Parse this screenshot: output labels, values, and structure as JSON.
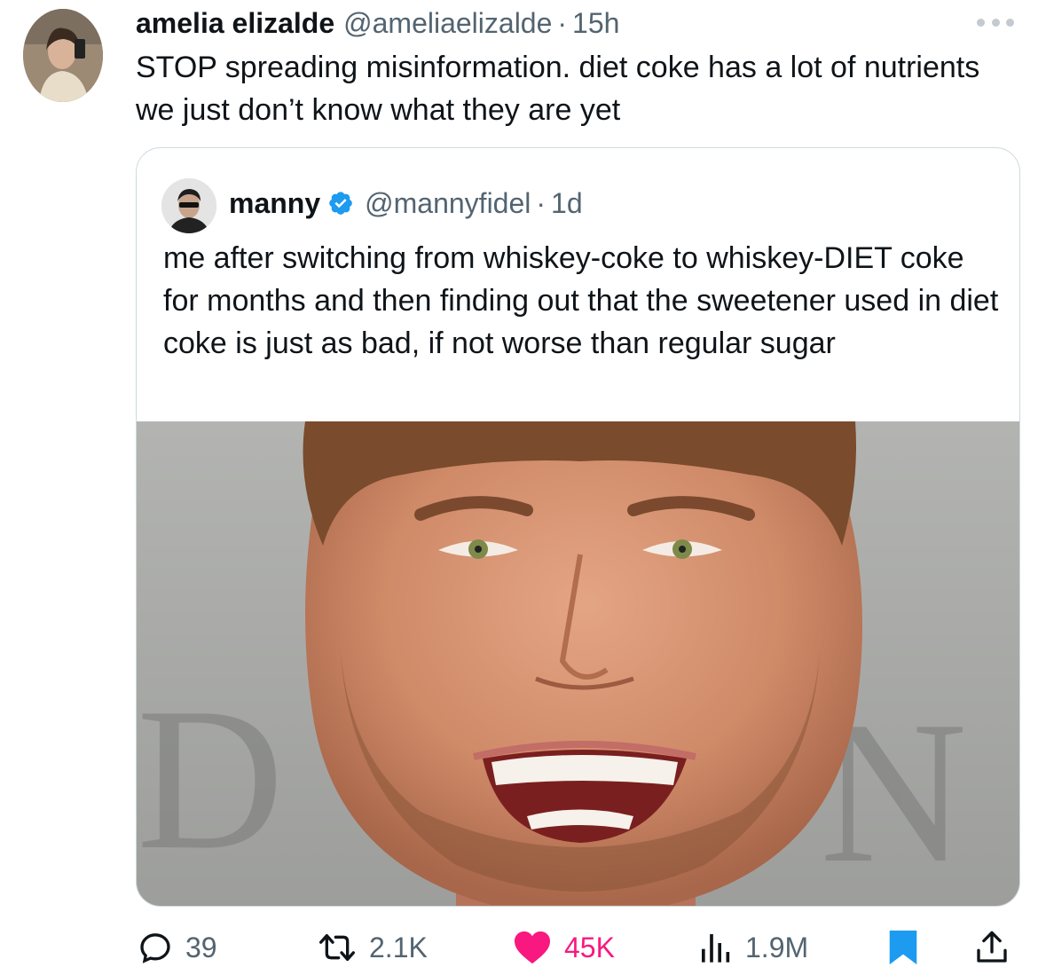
{
  "tweet": {
    "display_name": "amelia elizalde",
    "handle": "@ameliaelizalde",
    "separator": "·",
    "time": "15h",
    "text": "STOP spreading misinformation. diet coke has a lot of nutrients we just don’t know what they are yet",
    "avatar_icon": "profile-photo",
    "more_icon": "more-options-icon"
  },
  "quoted": {
    "display_name": "manny",
    "verified": true,
    "verified_color": "#1d9bf0",
    "handle": "@mannyfidel",
    "separator": "·",
    "time": "1d",
    "text": "me after switching from whiskey-coke to whiskey-DIET coke for months and then finding out that the sweetener used in diet coke is just as bad, if not worse than regular sugar",
    "media": "photo of a man grinning widely, close-up of face"
  },
  "actions": {
    "reply_count": "39",
    "retweet_count": "2.1K",
    "like_count": "45K",
    "like_color": "#f91880",
    "liked": true,
    "views_count": "1.9M",
    "bookmarked": true,
    "bookmark_color": "#1d9bf0"
  }
}
